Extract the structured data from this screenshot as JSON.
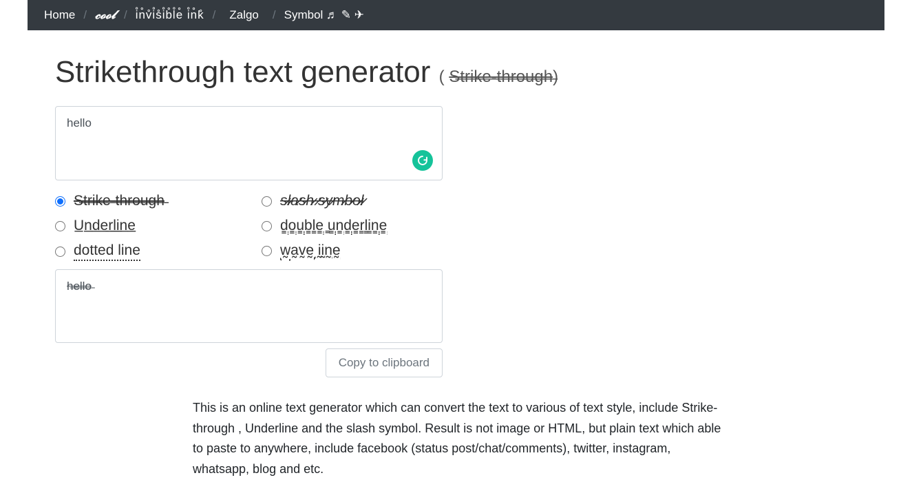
{
  "nav": {
    "home": "Home",
    "cool": "𝓬𝓸𝓸𝓵",
    "invisible": "i̊n̊v̊i̊s̊i̊b̊l̊e̊ i̊n̊k̊",
    "zalgo": "Zalgo",
    "zalgo_glitch": "҉̵̞̟̠̖̗͇̿̀͆͊̅͛͑̂̓ ̷̨̡̢̛̝̀́̂̃̄̅̆̇̈̉̊ ҉̧̨̛̛̘̙̜̝̞̀́̂̃̄̅ ̴̧̨̢̧̛̛̪̫̬̀́̂̃̄̅̆ ̵̡̨̧̛̛̭̮̯̀́̂̃̄̅̆̇ ̶̧̨̡̛̛̰̱̲̀́̂̃̄̅̆̇",
    "symbol": "Symbol ♬ ✎ ✈"
  },
  "title": {
    "main": "Strikethrough text generator",
    "sub_open": "( ",
    "sub_strike": "S̶t̶r̶i̶k̶e̶-̶t̶h̶r̶o̶u̶g̶h̶",
    "sub_close": ")"
  },
  "input_value": "hello",
  "options": {
    "strike": "S̶t̶r̶i̶k̶e̶-̶t̶h̶r̶o̶u̶g̶h̶",
    "underline": "U̲n̲d̲e̲r̲l̲i̲n̲e̲",
    "dotted": "dotted line",
    "slash": "s̷l̷a̷s̷h̷ ̷s̷y̷m̷b̷o̷l̷",
    "double": "d̳o̳u̳b̳l̳e̳ ̳u̳n̳d̳e̳r̳l̳i̳n̳e̳",
    "wave": "w̰a̰v̰ḛ ḭḭn̰ḛ"
  },
  "output_value": "h̶e̶l̶l̶o̶",
  "copy_label": "Copy to clipboard",
  "description": "This is an online text generator which can convert the text to various of text style, include Strike-through , Underline and the slash symbol. Result is not image or HTML, but plain text which able to paste to anywhere, include facebook (status post/chat/comments), twitter, instagram, whatsapp, blog and etc."
}
